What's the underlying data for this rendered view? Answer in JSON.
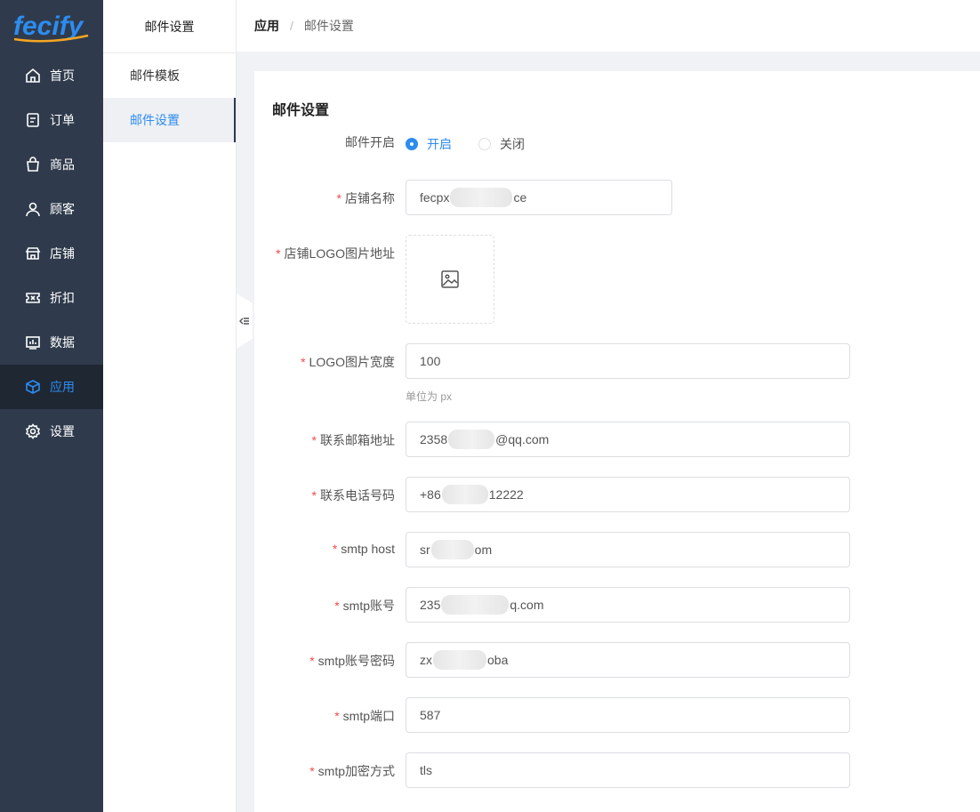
{
  "brand": {
    "logo_text": "fecify"
  },
  "nav": {
    "items": [
      {
        "label": "首页",
        "icon": "home-icon"
      },
      {
        "label": "订单",
        "icon": "order-icon"
      },
      {
        "label": "商品",
        "icon": "bag-icon"
      },
      {
        "label": "顾客",
        "icon": "user-icon"
      },
      {
        "label": "店铺",
        "icon": "store-icon"
      },
      {
        "label": "折扣",
        "icon": "ticket-icon"
      },
      {
        "label": "数据",
        "icon": "chart-icon"
      },
      {
        "label": "应用",
        "icon": "cube-icon",
        "active": true
      },
      {
        "label": "设置",
        "icon": "gear-icon"
      }
    ]
  },
  "submenu": {
    "title": "邮件设置",
    "items": [
      {
        "label": "邮件模板"
      },
      {
        "label": "邮件设置",
        "active": true
      }
    ]
  },
  "breadcrumb": {
    "root": "应用",
    "current": "邮件设置",
    "separator": "/"
  },
  "form": {
    "title": "邮件设置",
    "mail_enabled": {
      "label": "邮件开启",
      "options": [
        "开启",
        "关闭"
      ],
      "selected": "开启"
    },
    "store_name": {
      "label": "店铺名称",
      "value_start": "fecpx",
      "value_end": "ce"
    },
    "logo_url": {
      "label": "店铺LOGO图片地址"
    },
    "logo_width": {
      "label": "LOGO图片宽度",
      "value": "100",
      "hint": "单位为 px"
    },
    "contact_email": {
      "label": "联系邮箱地址",
      "value_start": "2358",
      "value_end": "@qq.com"
    },
    "contact_phone": {
      "label": "联系电话号码",
      "value_start": "+86",
      "value_end": "12222"
    },
    "smtp_host": {
      "label": "smtp host",
      "value_start": "sr",
      "value_end": "om"
    },
    "smtp_account": {
      "label": "smtp账号",
      "value_start": "235",
      "value_end": "q.com"
    },
    "smtp_password": {
      "label": "smtp账号密码",
      "value_start": "zx",
      "value_end": "oba"
    },
    "smtp_port": {
      "label": "smtp端口",
      "value": "587"
    },
    "smtp_encryption": {
      "label": "smtp加密方式",
      "value": "tls"
    }
  },
  "required_mark": "*",
  "colors": {
    "nav_bg": "#2f3b4c",
    "accent": "#2d8cf0",
    "required": "#f04b4b"
  }
}
